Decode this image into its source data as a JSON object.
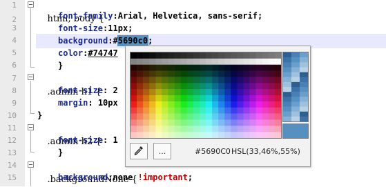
{
  "editor": {
    "line_numbers": [
      "1",
      "2",
      "3",
      "4",
      "5",
      "6",
      "7",
      "8",
      "9",
      "10",
      "11",
      "12",
      "13",
      "14",
      "15"
    ],
    "lines": {
      "l1_selector": "html, body {",
      "l2_prop": "font-family",
      "l2_val": "Arial, Helvetica, sans-serif;",
      "l3_prop": "font-size",
      "l3_val": "11px;",
      "l4_prop": "background",
      "l4_hash": "#",
      "l4_val": "5690c0",
      "l4_end": ";",
      "l5_prop": "color",
      "l5_val": "#74747",
      "l6_close": "}",
      "l7_selector": ".admin h1 {",
      "l8_prop": "font-size",
      "l8_val": "2",
      "l9_prop": "margin",
      "l9_val": "10px",
      "l10_close": "}",
      "l11_selector": ".admin h2 {",
      "l12_prop": "font-size",
      "l12_val": "1",
      "l13_close": "}",
      "l14_selector": ".backgroundNone {",
      "l15_prop": "background",
      "l15_val": "none ",
      "l15_important": "!important",
      "l15_end": ";"
    }
  },
  "color_picker": {
    "current_color": "#5690c0",
    "hex_label": "#5690C0",
    "hsl_label": "HSL(33,46%,55%)",
    "eyedropper_icon": "eyedropper-icon",
    "more_button_label": "..."
  },
  "colors": {
    "highlight_row": "#e8e8ff",
    "property": "#1a2a8c",
    "important": "#c00000",
    "swatch": "#5690c0"
  }
}
